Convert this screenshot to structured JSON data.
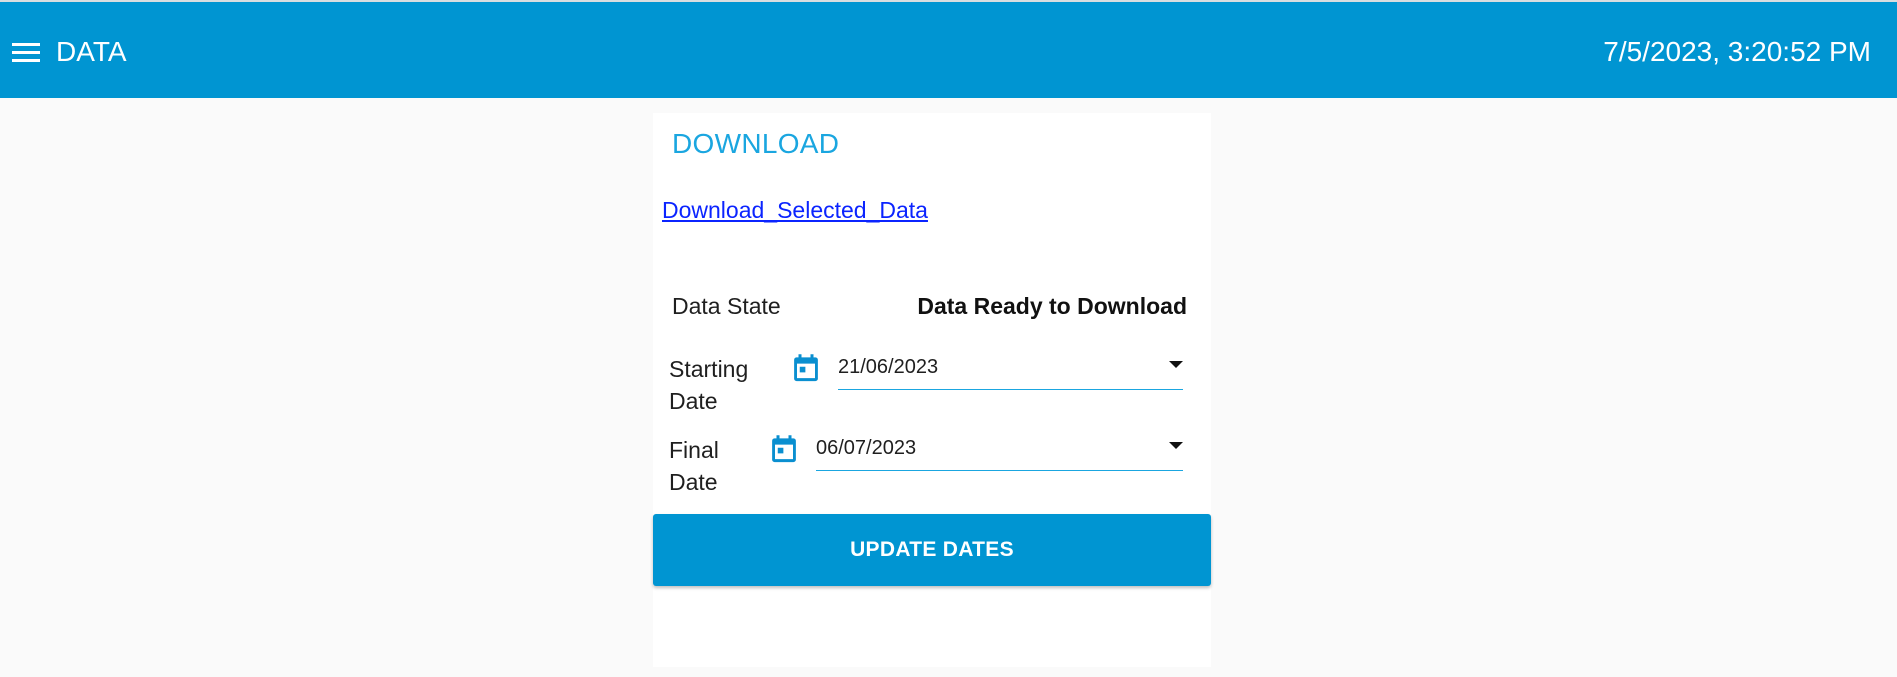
{
  "header": {
    "menu_icon": "hamburger-menu-icon",
    "title": "DATA",
    "datetime": "7/5/2023, 3:20:52 PM",
    "background_color": "#0095d2"
  },
  "card": {
    "title": "DOWNLOAD",
    "download_link": "Download_Selected_Data",
    "data_state": {
      "label": "Data State",
      "value": "Data Ready to Download"
    },
    "starting_date": {
      "label_line1": "Starting",
      "label_line2": "Date",
      "icon": "calendar-icon",
      "value": "21/06/2023"
    },
    "final_date": {
      "label_line1": "Final",
      "label_line2": "Date",
      "icon": "calendar-icon",
      "value": "06/07/2023"
    },
    "update_button_label": "UPDATE DATES",
    "accent_color": "#1aa6e0",
    "link_color": "#0b24ff"
  }
}
